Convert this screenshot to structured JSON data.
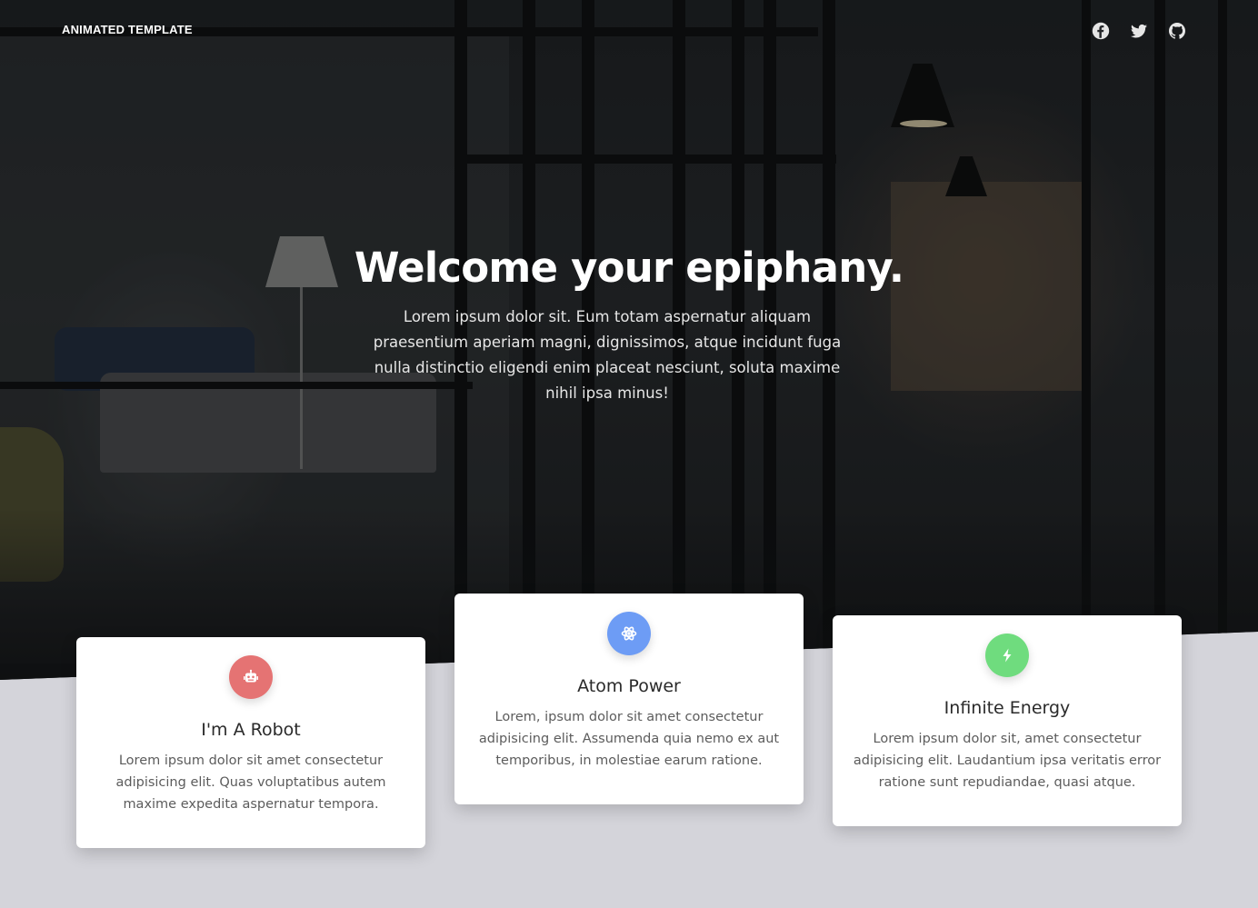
{
  "nav": {
    "brand": "ANIMATED TEMPLATE",
    "social": [
      {
        "icon": "facebook-icon"
      },
      {
        "icon": "twitter-icon"
      },
      {
        "icon": "github-icon"
      }
    ]
  },
  "hero": {
    "title": "Welcome your epiphany.",
    "lead": "Lorem ipsum dolor sit. Eum totam aspernatur aliquam praesentium aperiam magni, dignissimos, atque incidunt fuga nulla distinctio eligendi enim placeat nesciunt, soluta maxime nihil ipsa minus!"
  },
  "features": [
    {
      "icon": "robot-icon",
      "color": "#e57373",
      "title": "I'm A Robot",
      "text": "Lorem ipsum dolor sit amet consectetur adipisicing elit. Quas voluptatibus autem maxime expedita aspernatur tempora."
    },
    {
      "icon": "atom-icon",
      "color": "#6d9cf5",
      "title": "Atom Power",
      "text": "Lorem, ipsum dolor sit amet consectetur adipisicing elit. Assumenda quia nemo ex aut temporibus, in molestiae earum ratione."
    },
    {
      "icon": "bolt-icon",
      "color": "#6fdc7e",
      "title": "Infinite Energy",
      "text": "Lorem ipsum dolor sit, amet consectetur adipisicing elit. Laudantium ipsa veritatis error ratione sunt repudiandae, quasi atque."
    }
  ],
  "colors": {
    "section_bg": "#d4d4da",
    "card_bg": "#ffffff",
    "hero_overlay": "#1d1f22"
  }
}
